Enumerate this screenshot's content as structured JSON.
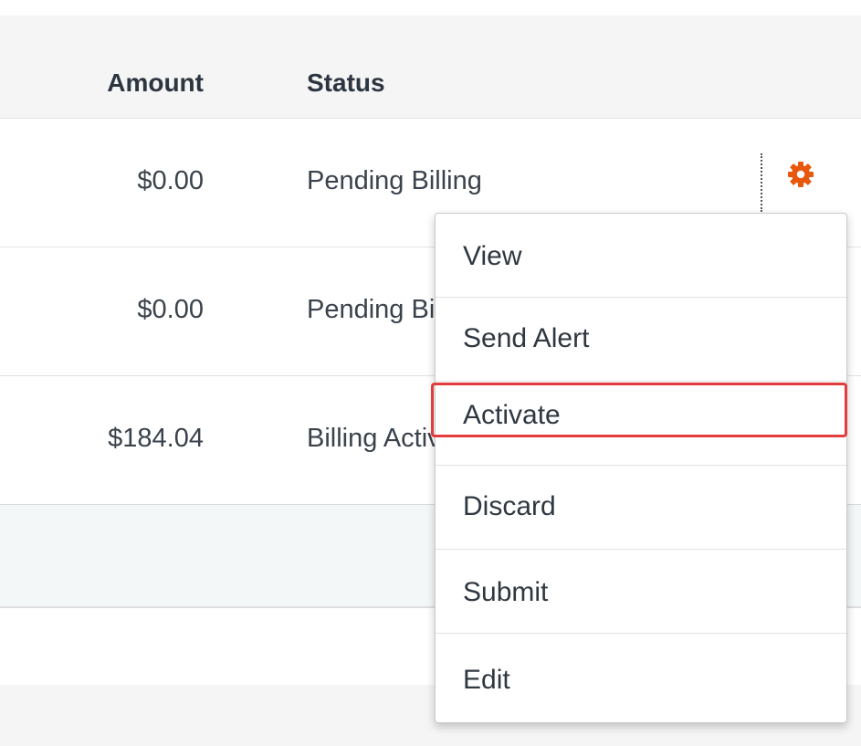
{
  "table": {
    "headers": {
      "amount": "Amount",
      "status": "Status"
    },
    "rows": [
      {
        "amount": "$0.00",
        "status": "Pending Billing"
      },
      {
        "amount": "$0.00",
        "status": "Pending Billing"
      },
      {
        "amount": "$184.04",
        "status": "Billing Active"
      }
    ]
  },
  "row_actions": {
    "icon": "gear-icon",
    "icon_color": "#e8580c"
  },
  "menu": {
    "items": [
      "View",
      "Send Alert",
      "Activate",
      "Discard",
      "Submit",
      "Edit"
    ],
    "highlighted": "Activate",
    "highlight_color": "#e23c3c"
  }
}
